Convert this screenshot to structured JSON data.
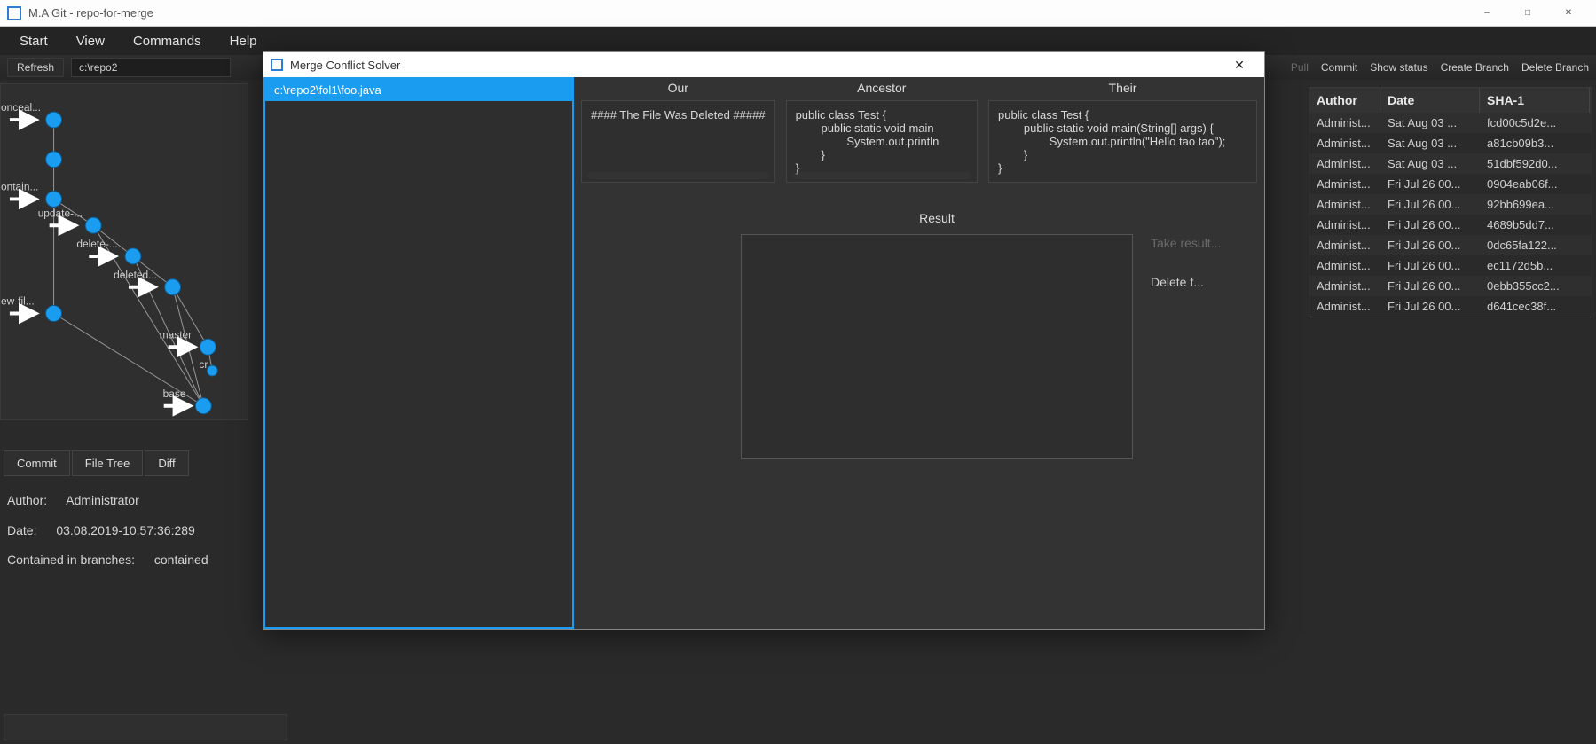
{
  "window": {
    "title": "M.A Git - repo-for-merge"
  },
  "menu": {
    "items": [
      "Start",
      "View",
      "Commands",
      "Help"
    ]
  },
  "toolbar": {
    "refresh": "Refresh",
    "path": "c:\\repo2",
    "right": {
      "pull": "Pull",
      "commit": "Commit",
      "show_status": "Show status",
      "create_branch": "Create Branch",
      "delete_branch": "Delete Branch"
    }
  },
  "graph": {
    "labels": [
      "onceal...",
      "ontain...",
      "update-...",
      "delete-...",
      "deleted...",
      "ew-fil...",
      "master",
      "cr...",
      "base"
    ]
  },
  "tabs": [
    "Commit",
    "File Tree",
    "Diff"
  ],
  "commit_details": {
    "author_label": "Author:",
    "author_value": "Administrator",
    "date_label": "Date:",
    "date_value": "03.08.2019-10:57:36:289",
    "branches_label": "Contained in branches:",
    "branches_value": "contained"
  },
  "commits_table": {
    "headers": {
      "author": "Author",
      "date": "Date",
      "sha": "SHA-1"
    },
    "rows": [
      {
        "author": "Administ...",
        "date": "Sat Aug 03 ...",
        "sha": "fcd00c5d2e..."
      },
      {
        "author": "Administ...",
        "date": "Sat Aug 03 ...",
        "sha": "a81cb09b3..."
      },
      {
        "author": "Administ...",
        "date": "Sat Aug 03 ...",
        "sha": "51dbf592d0..."
      },
      {
        "author": "Administ...",
        "date": "Fri Jul 26 00...",
        "sha": "0904eab06f..."
      },
      {
        "author": "Administ...",
        "date": "Fri Jul 26 00...",
        "sha": "92bb699ea..."
      },
      {
        "author": "Administ...",
        "date": "Fri Jul 26 00...",
        "sha": "4689b5dd7..."
      },
      {
        "author": "Administ...",
        "date": "Fri Jul 26 00...",
        "sha": "0dc65fa122..."
      },
      {
        "author": "Administ...",
        "date": "Fri Jul 26 00...",
        "sha": "ec1172d5b..."
      },
      {
        "author": "Administ...",
        "date": "Fri Jul 26 00...",
        "sha": "0ebb355cc2..."
      },
      {
        "author": "Administ...",
        "date": "Fri Jul 26 00...",
        "sha": "d641cec38f..."
      }
    ]
  },
  "modal": {
    "title": "Merge Conflict Solver",
    "conflict_file": "c:\\repo2\\fol1\\foo.java",
    "panes": {
      "our_header": "Our",
      "our_text": "#### The File Was Deleted #####",
      "ancestor_header": "Ancestor",
      "ancestor_text": "public class Test {\n        public static void main\n                System.out.println\n        }\n}",
      "their_header": "Their",
      "their_text": "public class Test {\n        public static void main(String[] args) {\n                System.out.println(\"Hello tao tao\");\n        }\n}"
    },
    "result": {
      "header": "Result",
      "take_result": "Take result...",
      "delete_file": "Delete f..."
    }
  }
}
